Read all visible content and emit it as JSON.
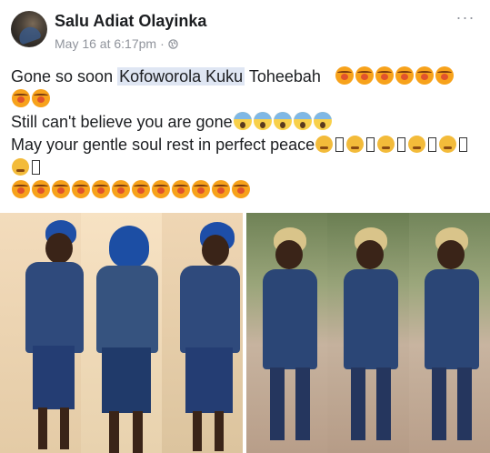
{
  "post": {
    "author": "Salu Adiat Olayinka",
    "date": "May 16 at 6:17pm",
    "separator": "·",
    "more_label": "···",
    "text": {
      "line1_before": "Gone so soon ",
      "mention": "Kofoworola Kuku",
      "line1_after": " Toheebah",
      "line3": "Still can't believe you are gone",
      "line4": "May your gentle soul rest in perfect peace"
    }
  },
  "icons": {
    "privacy": "globe-icon",
    "emoji_crying": "sleepy-face-icon",
    "emoji_scream": "scream-face-icon",
    "emoji_sad": "persevering-face-icon"
  }
}
